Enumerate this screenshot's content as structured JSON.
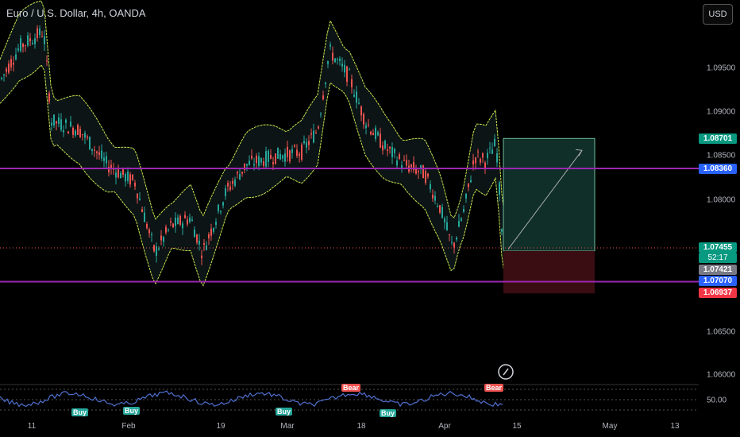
{
  "header": {
    "title": "Euro / U.S. Dollar, 4h, OANDA",
    "currency_button": "USD"
  },
  "colors": {
    "background": "#000000",
    "up_candle": "#26a69a",
    "down_candle": "#ef5350",
    "band": "#c8e64c",
    "horizontal_line": "#9c27b0",
    "target_zone": "#0f2f28",
    "stop_zone": "#3a0d12",
    "rsi_line": "#4f6fcf",
    "price_tag_green": "#089981",
    "price_tag_blue": "#2962ff",
    "price_tag_red": "#f23645",
    "price_tag_gray": "#787b86"
  },
  "chart_data": {
    "type": "candlestick",
    "instrument": "Euro / U.S. Dollar, 4h, OANDA",
    "y_ticks": [
      "1.09500",
      "1.09000",
      "1.08500",
      "1.08000",
      "1.06500",
      "1.06000"
    ],
    "x_ticks": [
      "11",
      "Feb",
      "19",
      "Mar",
      "18",
      "Apr",
      "15",
      "May",
      "13"
    ],
    "horizontal_lines": [
      {
        "price": 1.0836,
        "color": "#9c27b0"
      },
      {
        "price": 1.0707,
        "color": "#9c27b0"
      }
    ],
    "price_tags": [
      {
        "price": "1.08701",
        "color": "green"
      },
      {
        "price": "1.08360",
        "color": "blue"
      },
      {
        "price": "1.07455",
        "color": "green",
        "countdown": "52:17"
      },
      {
        "price": "1.07421",
        "color": "gray"
      },
      {
        "price": "1.07070",
        "color": "blue"
      },
      {
        "price": "1.06937",
        "color": "red"
      }
    ],
    "position": {
      "entry": 1.07421,
      "target": 1.08701,
      "stop": 1.06937
    },
    "rsi": {
      "level_label": "50.00",
      "signals": [
        {
          "label": "Buy"
        },
        {
          "label": "Buy"
        },
        {
          "label": "Buy"
        },
        {
          "label": "Buy"
        },
        {
          "label": "Bear"
        },
        {
          "label": "Bear"
        }
      ]
    }
  }
}
